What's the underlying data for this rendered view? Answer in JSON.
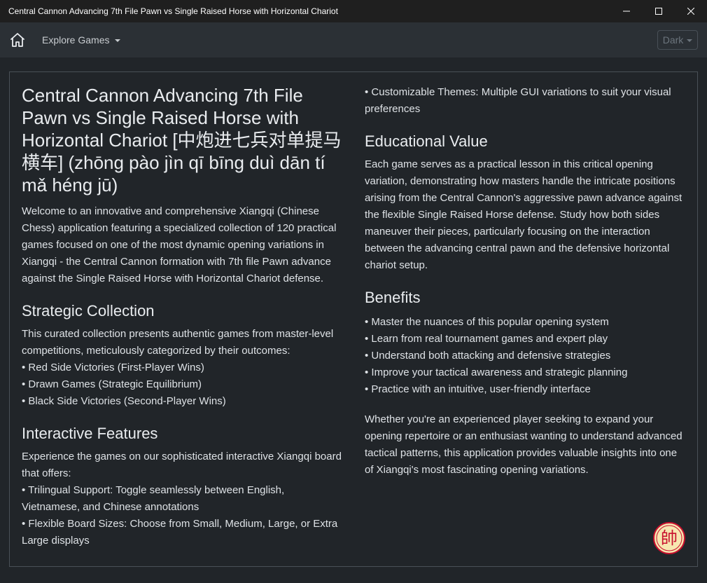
{
  "window": {
    "title": "Central Cannon Advancing 7th File Pawn vs Single Raised Horse with Horizontal Chariot"
  },
  "navbar": {
    "explore_label": "Explore Games",
    "theme_label": "Dark"
  },
  "content": {
    "main_title": "Central Cannon Advancing 7th File Pawn vs Single Raised Horse with Horizontal Chariot [中炮进七兵对单提马横车] (zhōng pào jìn qī bīng duì dān tí mǎ héng jū)",
    "intro": "Welcome to an innovative and comprehensive Xiangqi (Chinese Chess) application featuring a specialized collection of 120 practical games focused on one of the most dynamic opening variations in Xiangqi - the Central Cannon formation with 7th file Pawn advance against the Single Raised Horse with Horizontal Chariot defense.",
    "strategic": {
      "heading": "Strategic Collection",
      "text": "This curated collection presents authentic games from master-level competitions, meticulously categorized by their outcomes:",
      "items": [
        "• Red Side Victories (First-Player Wins)",
        "• Drawn Games (Strategic Equilibrium)",
        "• Black Side Victories (Second-Player Wins)"
      ]
    },
    "interactive": {
      "heading": "Interactive Features",
      "text": "Experience the games on our sophisticated interactive Xiangqi board that offers:",
      "items": [
        "• Trilingual Support: Toggle seamlessly between English, Vietnamese, and Chinese annotations",
        "• Flexible Board Sizes: Choose from Small, Medium, Large, or Extra Large displays",
        "• Customizable Themes: Multiple GUI variations to suit your visual preferences"
      ]
    },
    "educational": {
      "heading": "Educational Value",
      "text": "Each game serves as a practical lesson in this critical opening variation, demonstrating how masters handle the intricate positions arising from the Central Cannon's aggressive pawn advance against the flexible Single Raised Horse defense. Study how both sides maneuver their pieces, particularly focusing on the interaction between the advancing central pawn and the defensive horizontal chariot setup."
    },
    "benefits": {
      "heading": "Benefits",
      "items": [
        "• Master the nuances of this popular opening system",
        "• Learn from real tournament games and expert play",
        "• Understand both attacking and defensive strategies",
        "• Improve your tactical awareness and strategic planning",
        "• Practice with an intuitive, user-friendly interface"
      ]
    },
    "closing": "Whether you're an experienced player seeking to expand your opening repertoire or an enthusiast wanting to understand advanced tactical patterns, this application provides valuable insights into one of Xiangqi's most fascinating opening variations.",
    "logo_char": "帥"
  },
  "colors": {
    "background": "#212529",
    "navbar": "#2b3035",
    "titlebar": "#1f1f1f",
    "logo_red": "#c8102e",
    "logo_fill": "#f7e6b0"
  },
  "icons": [
    "home-icon",
    "minimize-icon",
    "maximize-icon",
    "close-icon",
    "caret-down-icon"
  ]
}
